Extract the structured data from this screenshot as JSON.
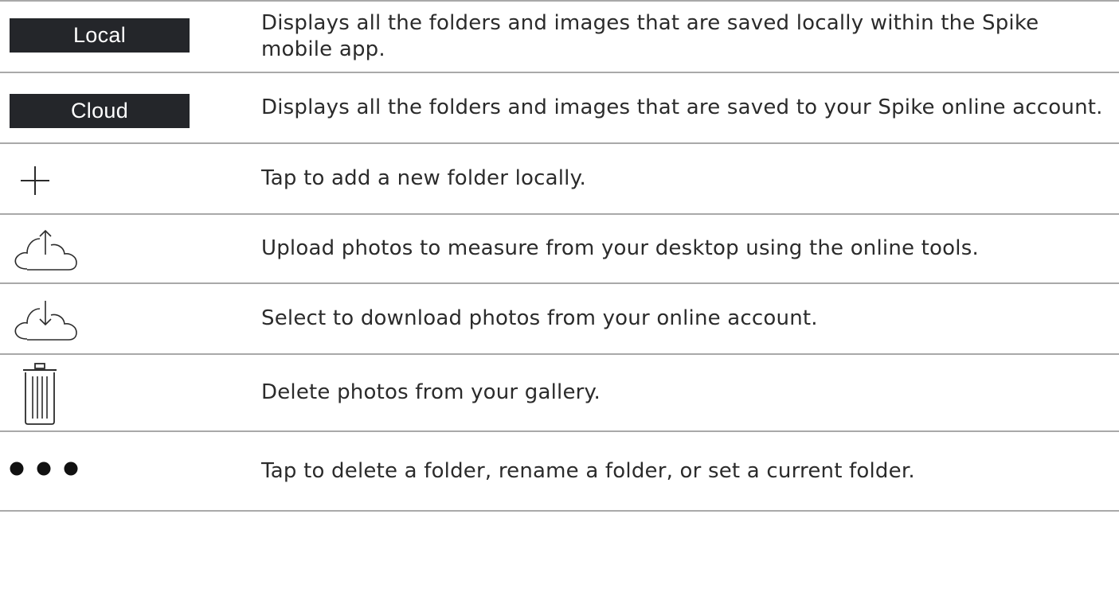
{
  "rows": [
    {
      "icon": "local-tab-button",
      "label": "Local",
      "description": "Displays all the folders and images that are saved locally within the Spike mobile app."
    },
    {
      "icon": "cloud-tab-button",
      "label": "Cloud",
      "description": "Displays all the folders and images that are saved to your Spike online account."
    },
    {
      "icon": "plus-icon",
      "description": "Tap to add a new folder locally."
    },
    {
      "icon": "cloud-upload-icon",
      "description": "Upload photos to measure from your desktop using the online tools."
    },
    {
      "icon": "cloud-download-icon",
      "description": "Select to download photos from your online account."
    },
    {
      "icon": "trash-icon",
      "description": "Delete photos from your gallery."
    },
    {
      "icon": "more-dots-icon",
      "description": "Tap to delete a folder, rename a folder, or set a current folder."
    }
  ],
  "colors": {
    "pill_background": "#24262a",
    "pill_text": "#ffffff",
    "divider": "#a9a9a9",
    "text": "#2b2b2b"
  }
}
